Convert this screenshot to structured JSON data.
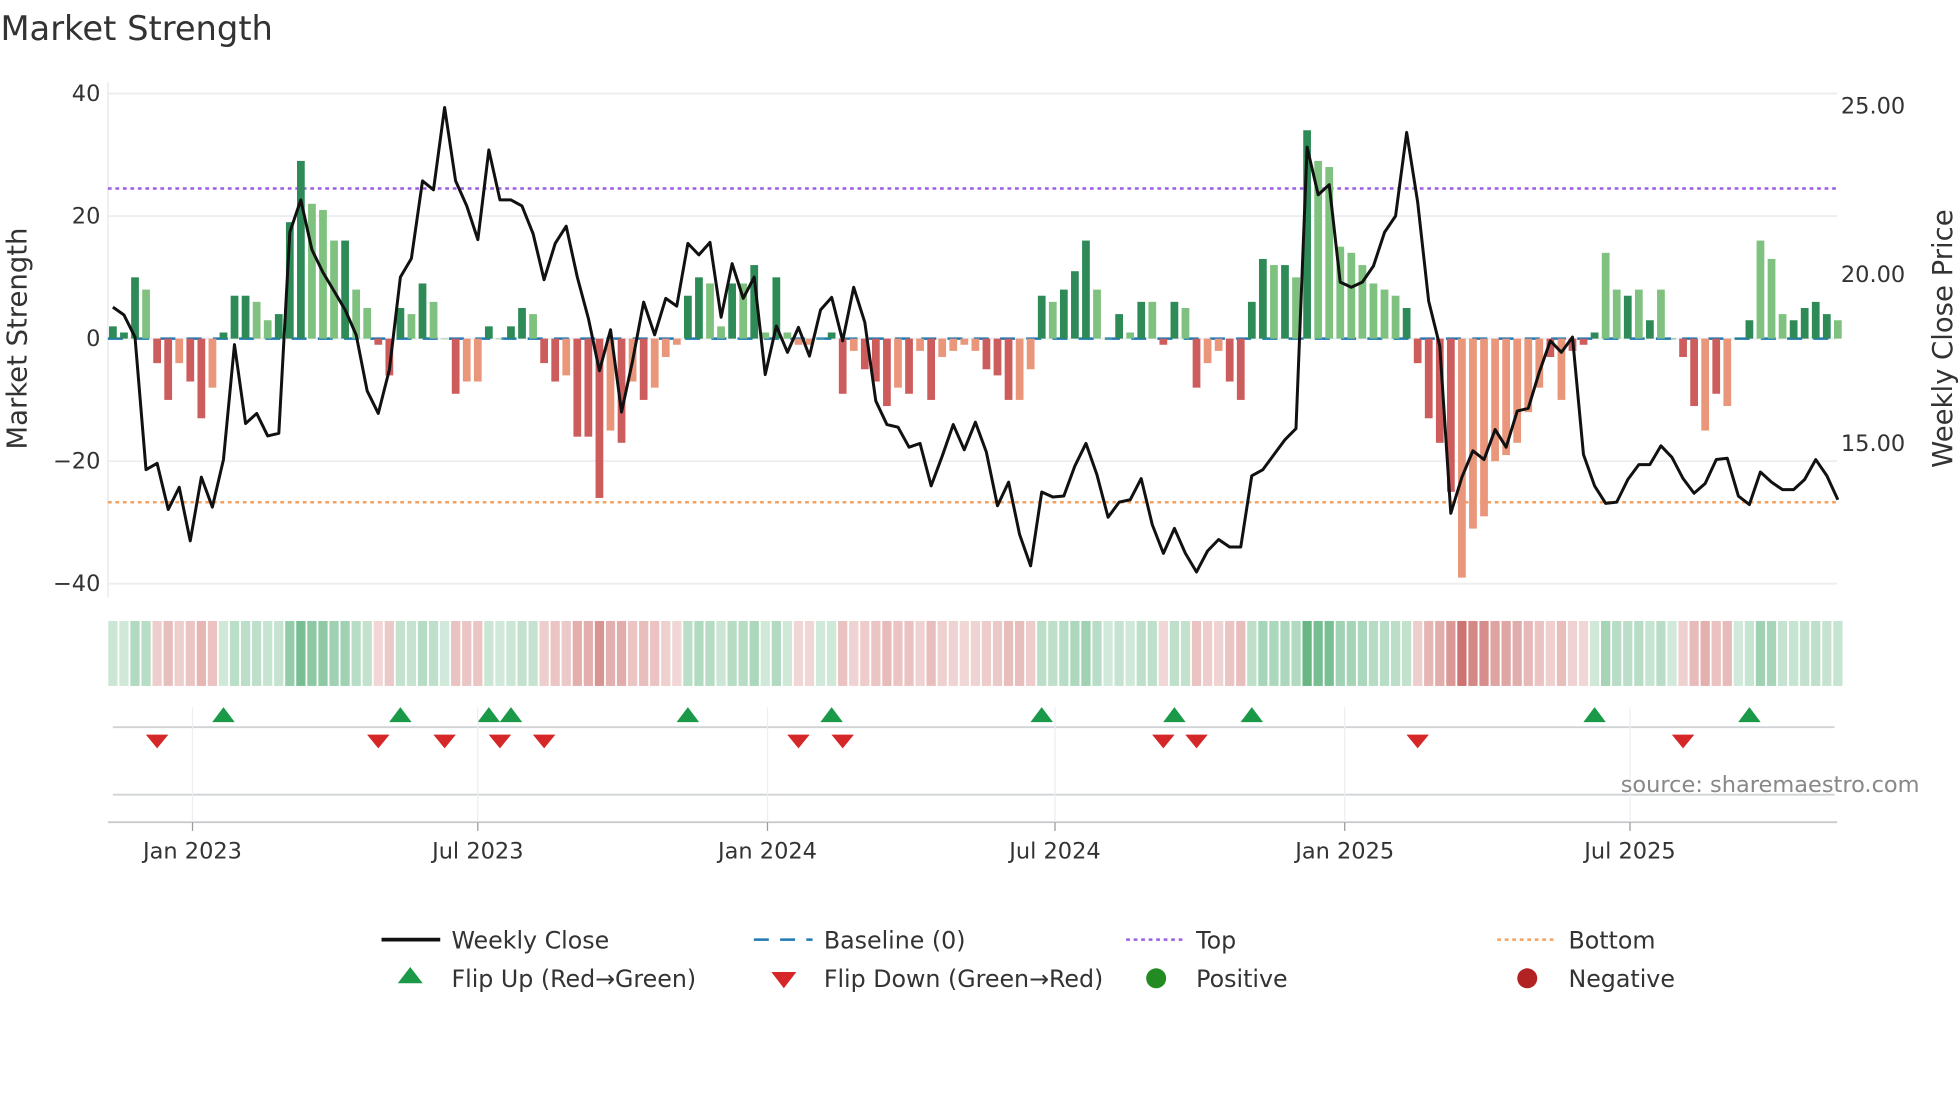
{
  "chart_data": {
    "type": "bar",
    "title": "Market Strength",
    "ylabel": "Market Strength",
    "y2label": "Weekly Close Price",
    "ylim": [
      -42.2,
      41.8
    ],
    "y2lim": [
      10.44,
      25.7
    ],
    "yticks": [
      {
        "v": 40,
        "label": "40"
      },
      {
        "v": 20,
        "label": "20"
      },
      {
        "v": 0,
        "label": "0"
      },
      {
        "v": -20,
        "label": "−20"
      },
      {
        "v": -40,
        "label": "−40"
      }
    ],
    "y2ticks": [
      {
        "v": 25,
        "label": "25.00"
      },
      {
        "v": 20,
        "label": "20.00"
      },
      {
        "v": 15,
        "label": "15.00"
      }
    ],
    "xticks": [
      {
        "week": 7.2,
        "label": "Jan 2023"
      },
      {
        "week": 33,
        "label": "Jul 2023"
      },
      {
        "week": 59.2,
        "label": "Jan 2024"
      },
      {
        "week": 85.2,
        "label": "Jul 2024"
      },
      {
        "week": 111.4,
        "label": "Jan 2025"
      },
      {
        "week": 137.2,
        "label": "Jul 2025"
      }
    ],
    "top": 24.5,
    "bottom": -26.7,
    "strength": [
      2,
      1,
      10,
      8,
      -4,
      -10,
      -4,
      -7,
      -13,
      -8,
      1,
      7,
      7,
      6,
      3,
      4,
      19,
      29,
      22,
      21,
      16,
      16,
      8,
      5,
      -1,
      -6,
      5,
      4,
      9,
      6,
      0,
      -9,
      -7,
      -7,
      2,
      0,
      2,
      5,
      4,
      -4,
      -7,
      -6,
      -16,
      -16,
      -26,
      -15,
      -17,
      -7,
      -10,
      -8,
      -3,
      -1,
      7,
      10,
      9,
      2,
      9,
      9,
      12,
      1,
      10,
      1,
      -1,
      -1,
      0,
      1,
      -9,
      -2,
      -5,
      -7,
      -11,
      -8,
      -9,
      -2,
      -10,
      -3,
      -2,
      -1,
      -2,
      -5,
      -6,
      -10,
      -10,
      -5,
      7,
      6,
      8,
      11,
      16,
      8,
      0,
      4,
      1,
      6,
      6,
      -1,
      6,
      5,
      -8,
      -4,
      -2,
      -7,
      -10,
      6,
      13,
      12,
      12,
      10,
      34,
      29,
      28,
      15,
      14,
      12,
      9,
      8,
      7,
      5,
      -4,
      -13,
      -17,
      -25,
      -39,
      -31,
      -29,
      -20,
      -19,
      -17,
      -12,
      -8,
      -3,
      -10,
      -2,
      -1,
      1,
      14,
      8,
      7,
      8,
      3,
      8,
      0,
      -3,
      -11,
      -15,
      -9,
      -11,
      0,
      3,
      16,
      13,
      4,
      3,
      5,
      6,
      4,
      3
    ],
    "strong": [
      1,
      1,
      1,
      0,
      1,
      1,
      0,
      1,
      1,
      0,
      1,
      1,
      1,
      0,
      0,
      1,
      1,
      1,
      0,
      0,
      0,
      1,
      0,
      0,
      1,
      1,
      1,
      0,
      1,
      0,
      0,
      1,
      0,
      0,
      1,
      0,
      1,
      1,
      0,
      1,
      1,
      0,
      1,
      1,
      1,
      0,
      1,
      0,
      1,
      0,
      0,
      0,
      1,
      1,
      0,
      0,
      1,
      0,
      1,
      0,
      1,
      0,
      0,
      0,
      0,
      1,
      1,
      0,
      1,
      1,
      1,
      0,
      1,
      0,
      1,
      0,
      0,
      0,
      0,
      1,
      1,
      1,
      0,
      0,
      1,
      0,
      1,
      1,
      1,
      0,
      0,
      1,
      0,
      1,
      0,
      1,
      1,
      0,
      1,
      0,
      0,
      1,
      1,
      1,
      1,
      0,
      1,
      0,
      1,
      0,
      0,
      0,
      0,
      0,
      0,
      0,
      0,
      1,
      1,
      1,
      1,
      1,
      0,
      0,
      0,
      0,
      0,
      0,
      0,
      0,
      1,
      0,
      1,
      1,
      1,
      0,
      0,
      1,
      0,
      1,
      0,
      1,
      1,
      1,
      0,
      1,
      0,
      1,
      1,
      0,
      0,
      0,
      1,
      1,
      1,
      1
    ],
    "close": [
      19.04,
      18.81,
      18.15,
      14.22,
      14.41,
      13.04,
      13.7,
      12.11,
      14.0,
      13.11,
      14.52,
      17.93,
      15.59,
      15.89,
      15.22,
      15.3,
      21.26,
      22.22,
      20.74,
      20.07,
      19.52,
      18.96,
      18.22,
      16.56,
      15.89,
      17.19,
      19.93,
      20.48,
      22.78,
      22.52,
      24.96,
      22.78,
      22.04,
      21.04,
      23.7,
      22.22,
      22.22,
      22.04,
      21.22,
      19.85,
      20.93,
      21.44,
      19.93,
      18.7,
      17.15,
      18.37,
      15.93,
      17.44,
      19.19,
      18.22,
      19.3,
      19.07,
      20.93,
      20.59,
      20.96,
      18.74,
      20.33,
      19.3,
      19.93,
      17.04,
      18.48,
      17.7,
      18.44,
      17.59,
      18.96,
      19.33,
      18.04,
      19.63,
      18.59,
      16.26,
      15.56,
      15.48,
      14.89,
      15.0,
      13.74,
      14.63,
      15.56,
      14.81,
      15.63,
      14.74,
      13.15,
      13.85,
      12.3,
      11.37,
      13.56,
      13.41,
      13.44,
      14.33,
      15.0,
      14.07,
      12.81,
      13.26,
      13.33,
      13.96,
      12.59,
      11.74,
      12.48,
      11.74,
      11.19,
      11.81,
      12.15,
      11.93,
      11.93,
      14.04,
      14.22,
      14.67,
      15.11,
      15.44,
      23.78,
      22.37,
      22.67,
      19.78,
      19.63,
      19.78,
      20.26,
      21.26,
      21.74,
      24.22,
      22.15,
      19.22,
      17.89,
      12.93,
      14.0,
      14.78,
      14.52,
      15.41,
      14.89,
      15.96,
      16.04,
      17.11,
      18.04,
      17.7,
      18.15,
      14.67,
      13.74,
      13.22,
      13.26,
      13.93,
      14.37,
      14.37,
      14.93,
      14.59,
      13.96,
      13.52,
      13.81,
      14.52,
      14.56,
      13.44,
      13.19,
      14.15,
      13.85,
      13.63,
      13.63,
      13.93,
      14.52,
      14.04,
      13.33
    ],
    "flip_up_weeks": [
      10,
      26,
      34,
      36,
      52,
      65,
      84,
      96,
      103,
      134,
      148
    ],
    "flip_down_weeks": [
      4,
      24,
      30,
      35,
      39,
      62,
      66,
      95,
      98,
      118,
      142
    ],
    "colors": {
      "strong_pos": "#2e8b57",
      "weak_pos": "#7fc17f",
      "strong_neg": "#cd5c5c",
      "weak_neg": "#e9967a",
      "close": "#111111",
      "baseline": "#1f77b4",
      "top": "#9b5de5",
      "bottom": "#f4a261",
      "flip_up": "#1a9a48",
      "flip_down": "#d62728",
      "positive": "#228b22",
      "negative": "#b22222"
    },
    "legend": {
      "weekly_close": "Weekly Close",
      "baseline": "Baseline (0)",
      "top": "Top",
      "bottom": "Bottom",
      "flip_up": "Flip Up (Red→Green)",
      "flip_down": "Flip Down (Green→Red)",
      "positive": "Positive",
      "negative": "Negative"
    },
    "source": "source: sharemaestro.com"
  }
}
